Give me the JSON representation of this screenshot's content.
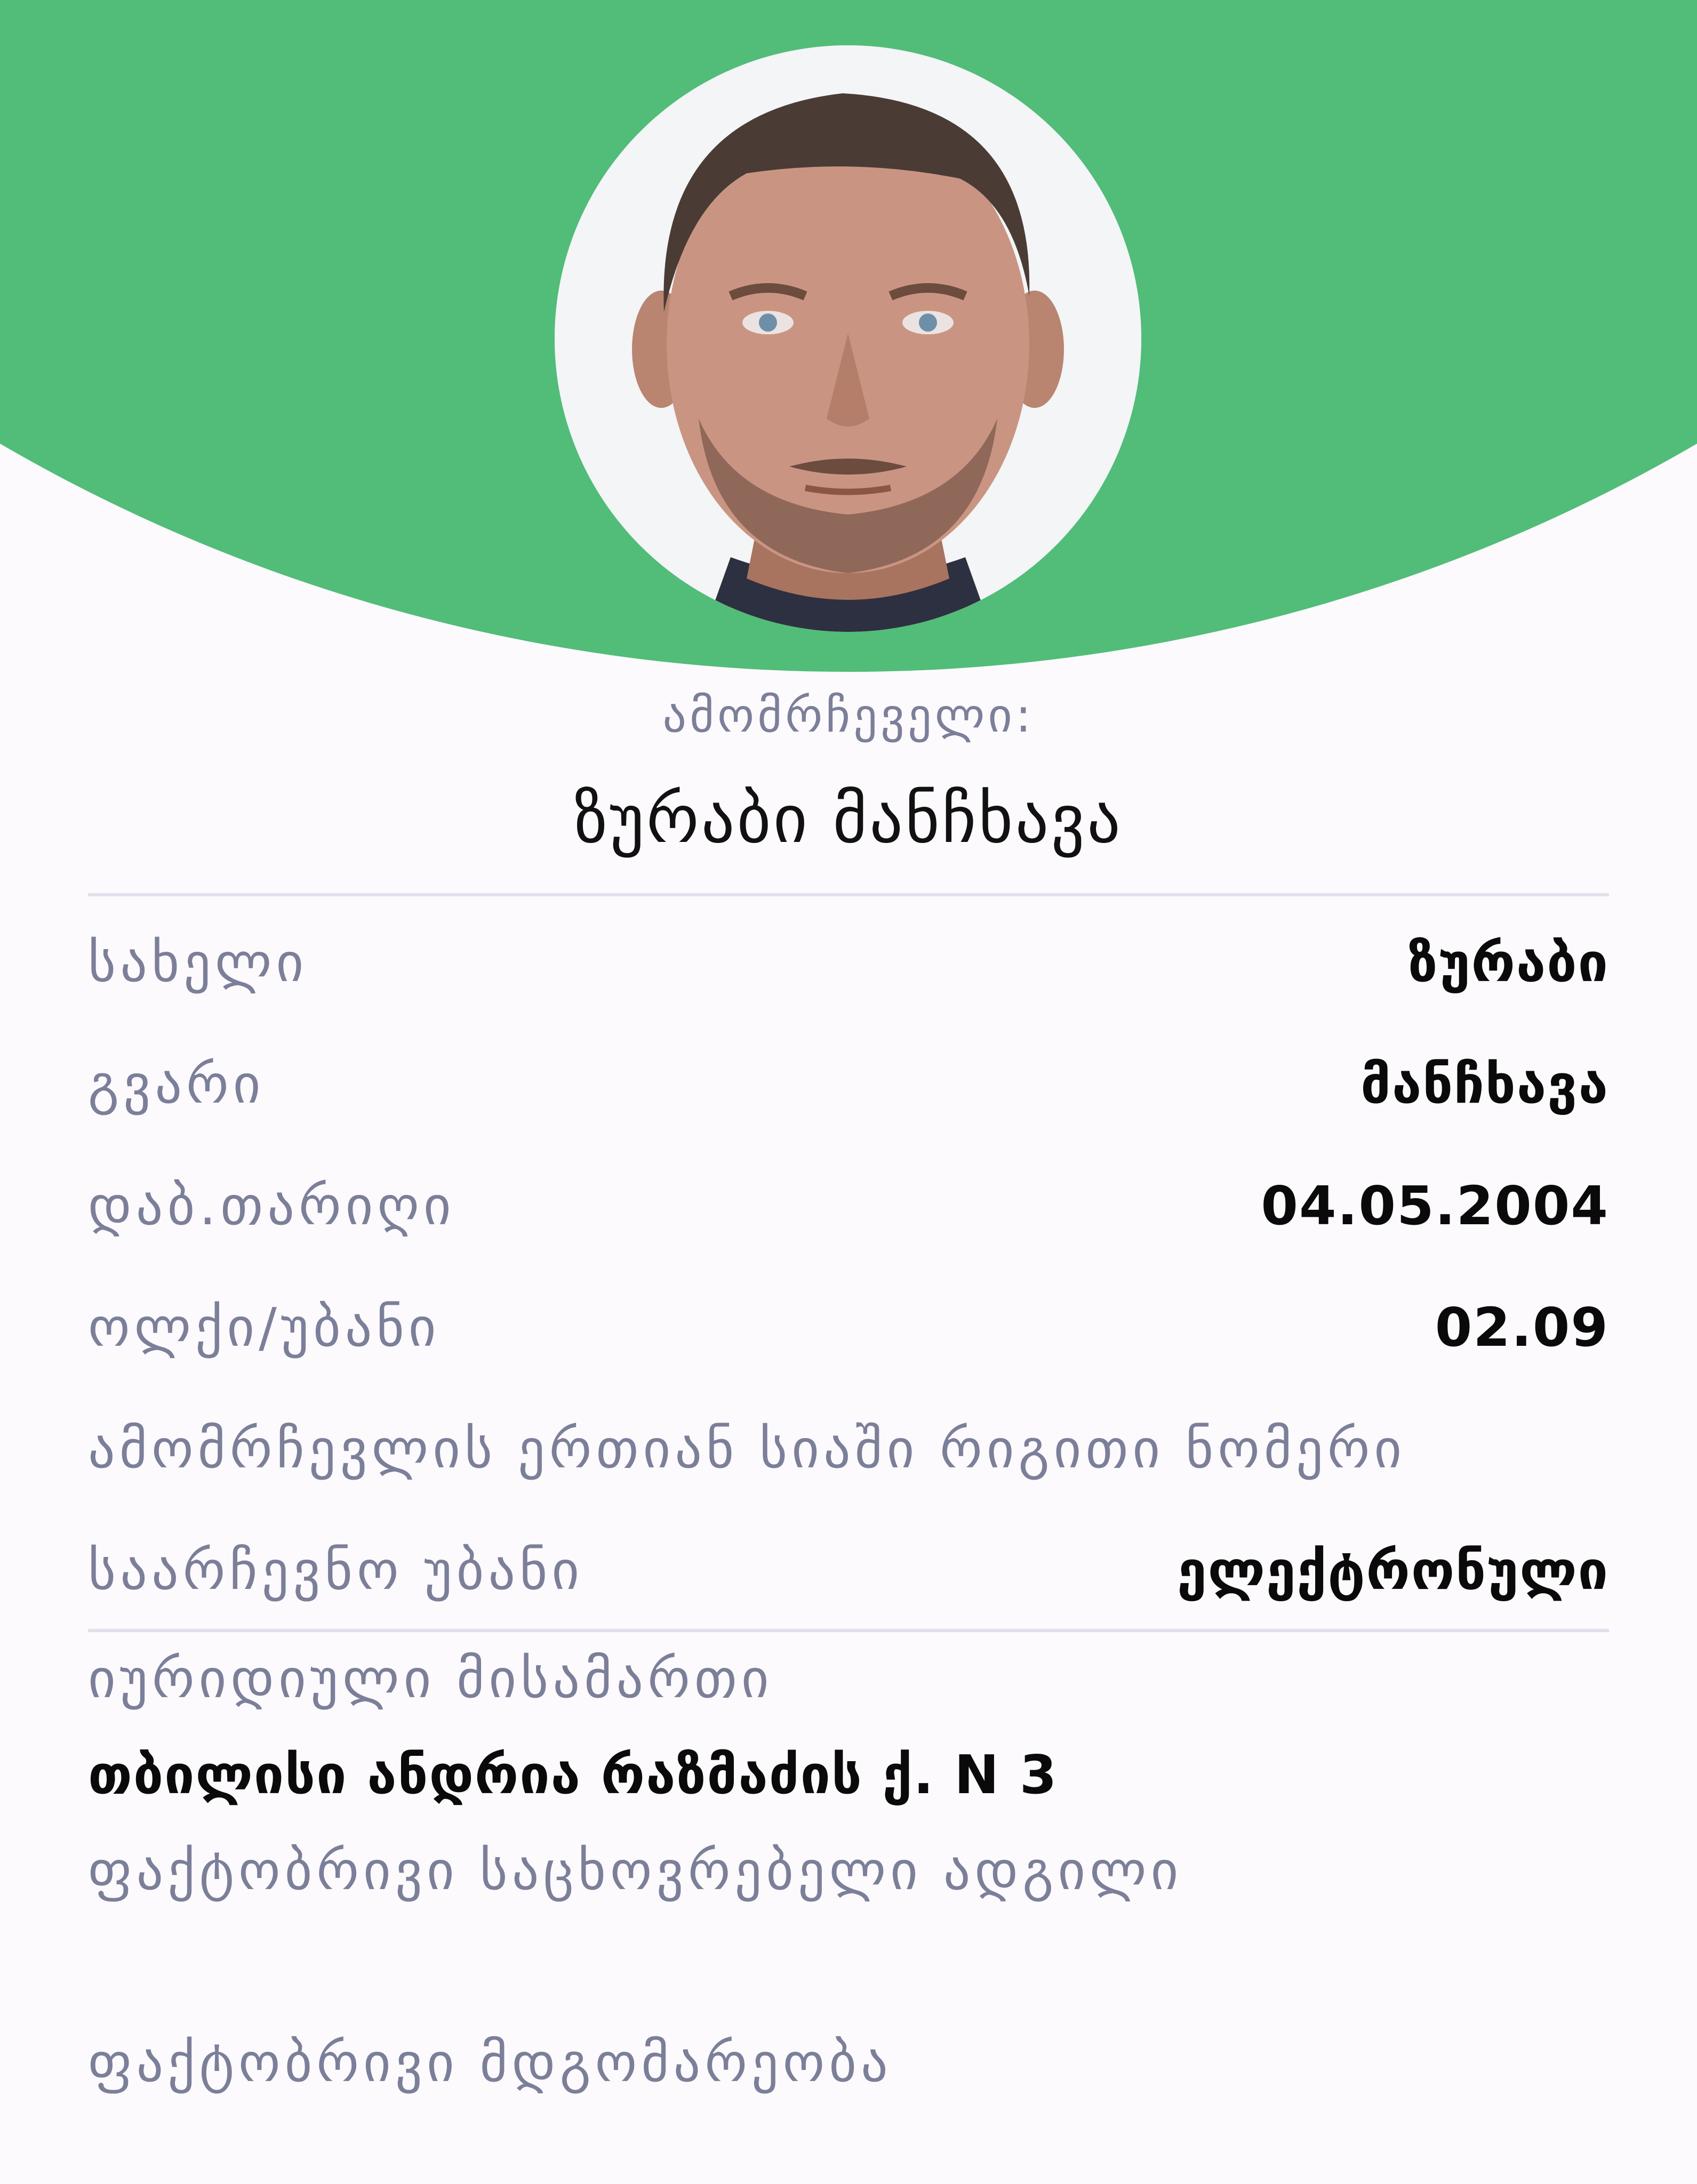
{
  "profile": {
    "caption": "ამომრჩეველი:",
    "full_name": "ზურაბი მანჩხავა",
    "photo_alt": "avatar-photo"
  },
  "fields": [
    {
      "label": "სახელი",
      "value": "ზურაბი"
    },
    {
      "label": "გვარი",
      "value": "მანჩხავა"
    },
    {
      "label": "დაბ.თარიღი",
      "value": "04.05.2004"
    },
    {
      "label": "ოლქი/უბანი",
      "value": "02.09"
    },
    {
      "label": "ამომრჩევლის ერთიან სიაში რიგითი ნომერი",
      "value": ""
    },
    {
      "label": "საარჩევნო უბანი",
      "value": "ელექტრონული"
    }
  ],
  "address": {
    "legal_label": "იურიდიული მისამართი",
    "legal_value": "თბილისი ანდრია რაზმაძის ქ. N 3",
    "actual_label": "ფაქტობრივი საცხოვრებელი ადგილი",
    "actual_value": "",
    "status_label": "ფაქტობრივი მდგომარეობა",
    "status_value": ""
  },
  "colors": {
    "accent_green": "#52bc79",
    "label_gray": "#7c7f99",
    "background": "#fcfafd"
  }
}
